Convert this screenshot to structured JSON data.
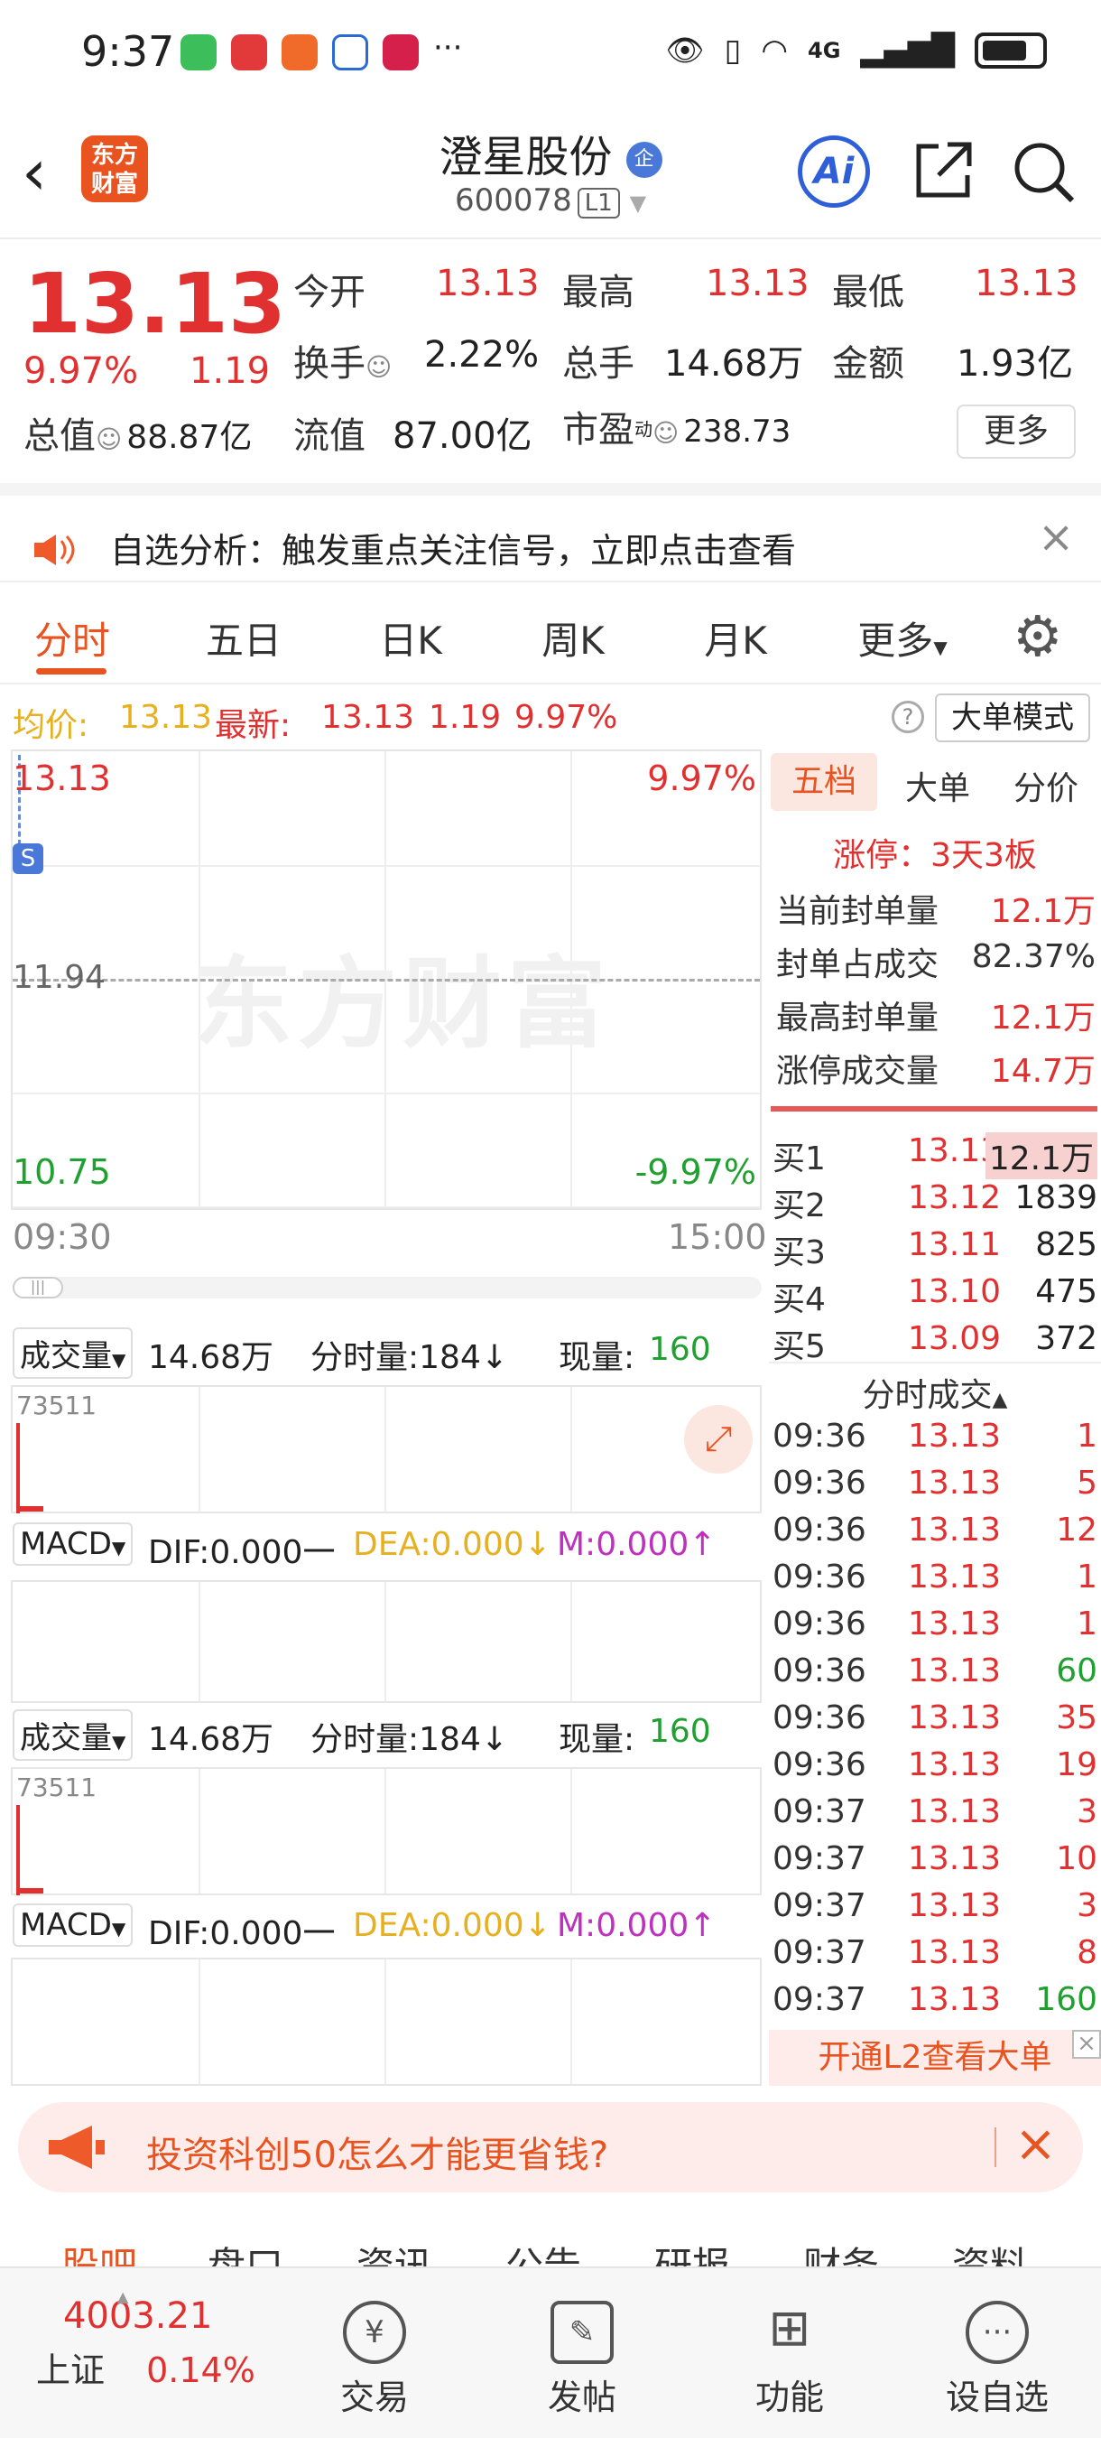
{
  "status": {
    "time": "9:37",
    "net": "4G"
  },
  "header": {
    "name": "澄星股份",
    "badge": "企",
    "code": "600078",
    "level": "L1",
    "ai": "Ai"
  },
  "quote": {
    "price": "13.13",
    "pct": "9.97%",
    "chg": "1.19",
    "open_label": "今开",
    "open": "13.13",
    "high_label": "最高",
    "high": "13.13",
    "low_label": "最低",
    "low": "13.13",
    "turnover_label": "换手",
    "turnover": "2.22%",
    "vol_label": "总手",
    "vol": "14.68万",
    "amt_label": "金额",
    "amt": "1.93亿",
    "mcap_label": "总值",
    "mcap": "88.87亿",
    "float_label": "流值",
    "float": "87.00亿",
    "pe_label": "市盈",
    "pe_sup": "动",
    "pe": "238.73",
    "more": "更多"
  },
  "notice": {
    "text": "自选分析：触发重点关注信号，立即点击查看"
  },
  "tabs": [
    "分时",
    "五日",
    "日K",
    "周K",
    "月K",
    "更多"
  ],
  "info": {
    "avg_label": "均价:",
    "avg": "13.13",
    "last_label": "最新:",
    "last": "13.13",
    "chg": "1.19",
    "pct": "9.97%",
    "mode": "大单模式"
  },
  "chart": {
    "top_price": "13.13",
    "top_pct": "9.97%",
    "mid": "11.94",
    "low_price": "10.75",
    "low_pct": "-9.97%",
    "t_start": "09:30",
    "t_end": "15:00",
    "marker": "S",
    "watermark": "东方财富"
  },
  "sub": {
    "vol_label": "成交量",
    "vol": "14.68万",
    "tick_label": "分时量:184↓",
    "cur_label": "现量:",
    "cur": "160",
    "ymax": "73511",
    "macd": "MACD",
    "dif": "DIF:0.000一",
    "dea": "DEA:0.000↓",
    "m": "M:0.000↑"
  },
  "side": {
    "tabs": [
      "五档",
      "大单",
      "分价"
    ],
    "limit": "涨停：3天3板",
    "stats": [
      {
        "k": "当前封单量",
        "v": "12.1万"
      },
      {
        "k": "封单占成交",
        "v": "82.37%"
      },
      {
        "k": "最高封单量",
        "v": "12.1万"
      },
      {
        "k": "涨停成交量",
        "v": "14.7万"
      }
    ],
    "bids": [
      {
        "k": "买1",
        "p": "13.13",
        "v": "12.1万"
      },
      {
        "k": "买2",
        "p": "13.12",
        "v": "1839"
      },
      {
        "k": "买3",
        "p": "13.11",
        "v": "825"
      },
      {
        "k": "买4",
        "p": "13.10",
        "v": "475"
      },
      {
        "k": "买5",
        "p": "13.09",
        "v": "372"
      }
    ],
    "ticks_title": "分时成交",
    "ticks": [
      {
        "t": "09:36",
        "p": "13.13",
        "v": "1"
      },
      {
        "t": "09:36",
        "p": "13.13",
        "v": "5"
      },
      {
        "t": "09:36",
        "p": "13.13",
        "v": "12"
      },
      {
        "t": "09:36",
        "p": "13.13",
        "v": "1"
      },
      {
        "t": "09:36",
        "p": "13.13",
        "v": "1"
      },
      {
        "t": "09:36",
        "p": "13.13",
        "v": "60"
      },
      {
        "t": "09:36",
        "p": "13.13",
        "v": "35"
      },
      {
        "t": "09:36",
        "p": "13.13",
        "v": "19"
      },
      {
        "t": "09:37",
        "p": "13.13",
        "v": "3"
      },
      {
        "t": "09:37",
        "p": "13.13",
        "v": "10"
      },
      {
        "t": "09:37",
        "p": "13.13",
        "v": "3"
      },
      {
        "t": "09:37",
        "p": "13.13",
        "v": "8"
      },
      {
        "t": "09:37",
        "p": "13.13",
        "v": "160"
      }
    ],
    "l2": "开通L2查看大单"
  },
  "ad": {
    "text": "投资科创50怎么才能更省钱?"
  },
  "bottom_tabs": [
    "股吧",
    "盘口",
    "资讯",
    "公告",
    "研报",
    "财务",
    "资料"
  ],
  "nav": {
    "index_value": "4003.21",
    "index_name": "上证",
    "index_pct": "0.14%",
    "items": [
      "交易",
      "发帖",
      "功能",
      "设自选"
    ]
  },
  "colors": {
    "up": "#e03030",
    "down": "#20a030",
    "accent": "#e8531f",
    "avg": "#e6b020",
    "macd_m": "#c030c0"
  }
}
